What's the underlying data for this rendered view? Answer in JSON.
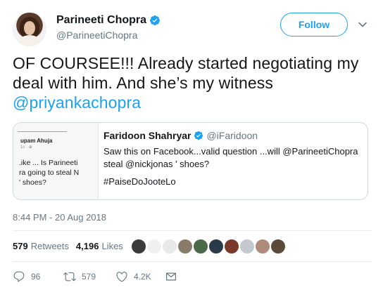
{
  "author": {
    "display_name": "Parineeti Chopra",
    "handle": "@ParineetiChopra",
    "verified": true
  },
  "follow_label": "Follow",
  "tweet": {
    "text_main": "OF COURSEE!!! Already started negotiating my deal with him. And she’s my witness ",
    "mention": "@priyankachopra"
  },
  "quoted_tweet": {
    "display_name": "Faridoon Shahryar",
    "handle": "@iFaridoon",
    "verified": true,
    "text": "Saw this on Facebook...valid question ...will @ParineetiChopra steal @nickjonas ' shoes?",
    "hashtag": "#PaiseDoJooteLo",
    "thumbnail": {
      "name": "upam Ahuja",
      "meta": "1s · ⊕",
      "text": ".ike ... Is Parineeti\nra going to steal N\n' shoes?"
    }
  },
  "timestamp": "8:44 PM - 20 Aug 2018",
  "stats": {
    "retweets_count": "579",
    "retweets_label": "Retweets",
    "likes_count": "4,196",
    "likes_label": "Likes"
  },
  "likers": [
    "#3a3a3a",
    "#f0f0f0",
    "#e8e8e8",
    "#8a7a6a",
    "#4a6a4a",
    "#2a3a4a",
    "#7a3a2a",
    "#c4c9cf",
    "#b08a7a",
    "#5a4a3a"
  ],
  "actions": {
    "replies": "96",
    "retweets": "579",
    "likes": "4.2K"
  },
  "colors": {
    "accent": "#1da1f2",
    "secondary_text": "#657786"
  }
}
